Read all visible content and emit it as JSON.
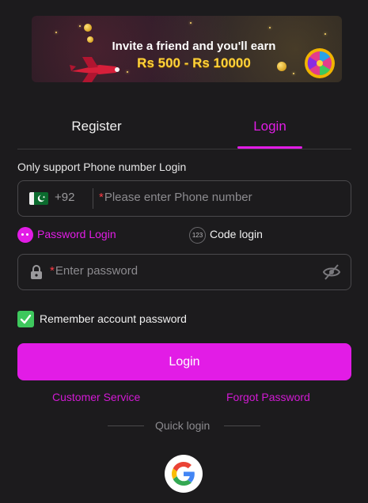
{
  "banner": {
    "title": "Invite a friend and you'll earn",
    "amount": "Rs 500 - Rs 10000"
  },
  "tabs": [
    {
      "label": "Register",
      "active": false
    },
    {
      "label": "Login",
      "active": true
    }
  ],
  "form": {
    "support_note": "Only support Phone number Login",
    "phone": {
      "country_code": "+92",
      "country_flag": "pakistan-flag-icon",
      "required_mark": "*",
      "placeholder": "Please enter Phone number"
    },
    "login_modes": {
      "password_label": "Password Login",
      "code_label": "Code login",
      "code_icon_text": "123",
      "selected": "password"
    },
    "password": {
      "required_mark": "*",
      "placeholder": "Enter password"
    },
    "remember": {
      "label": "Remember account password",
      "checked": true
    },
    "login_button": "Login"
  },
  "links": {
    "customer_service": "Customer Service",
    "forgot_password": "Forgot Password"
  },
  "quick_login": {
    "label": "Quick login",
    "providers": [
      "google-icon"
    ]
  },
  "colors": {
    "accent": "#e21ce6",
    "background": "#1c1b1d",
    "checkbox": "#3ec85d",
    "required": "#ff3c46"
  }
}
